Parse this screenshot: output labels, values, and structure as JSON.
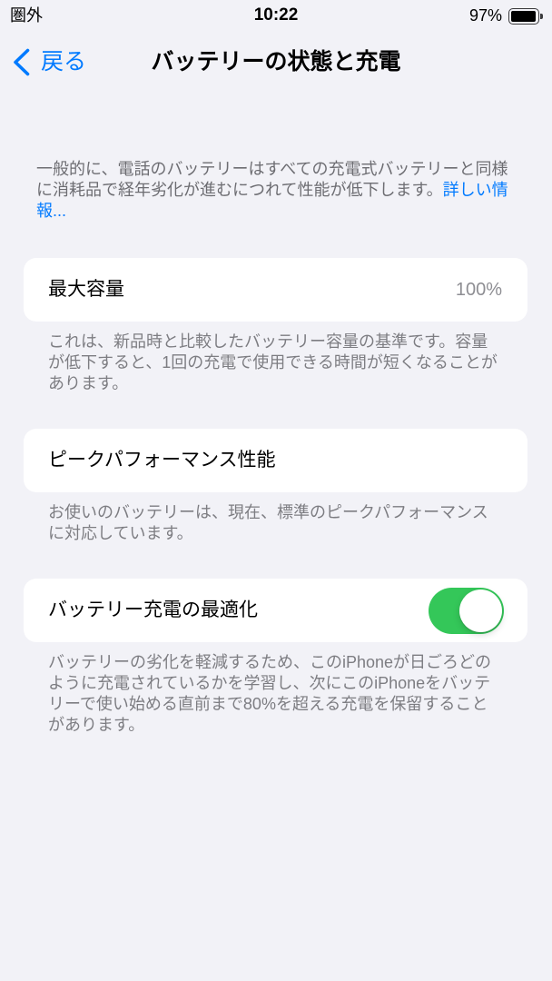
{
  "status_bar": {
    "carrier": "圏外",
    "time": "10:22",
    "battery_percent": "97%",
    "battery_level": 0.97,
    "battery_icon": "battery-icon"
  },
  "nav": {
    "back_icon": "chevron-left-icon",
    "back_label": "戻る",
    "title": "バッテリーの状態と充電"
  },
  "intro": {
    "text": "一般的に、電話のバッテリーはすべての充電式バッテリーと同様に消耗品で経年劣化が進むにつれて性能が低下します。",
    "link": "詳しい情報..."
  },
  "sections": {
    "max_capacity": {
      "label": "最大容量",
      "value": "100%",
      "footer": "これは、新品時と比較したバッテリー容量の基準です。容量が低下すると、1回の充電で使用できる時間が短くなることがあります。"
    },
    "peak_performance": {
      "label": "ピークパフォーマンス性能",
      "footer": "お使いのバッテリーは、現在、標準のピークパフォーマンスに対応しています。"
    },
    "optimized_charging": {
      "label": "バッテリー充電の最適化",
      "toggle_on": true,
      "footer": "バッテリーの劣化を軽減するため、このiPhoneが日ごろどのように充電されているかを学習し、次にこのiPhoneをバッテリーで使い始める直前まで80%を超える充電を保留することがあります。"
    }
  },
  "colors": {
    "accent": "#007aff",
    "toggle_on": "#34c759",
    "background": "#f2f2f7",
    "card": "#ffffff",
    "secondary_text": "#6d6d72",
    "footer_text": "#7d7d82",
    "value_text": "#8e8e93"
  }
}
